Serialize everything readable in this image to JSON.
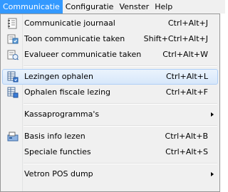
{
  "menubar": {
    "items": [
      {
        "label": "Communicatie"
      },
      {
        "label": "Configuratie"
      },
      {
        "label": "Venster"
      },
      {
        "label": "Help"
      }
    ]
  },
  "menu": {
    "items": [
      {
        "label": "Communicatie journaal",
        "shortcut": "Ctrl+Alt+J",
        "icon": "journal-icon"
      },
      {
        "label": "Toon communicatie taken",
        "shortcut": "Shift+Ctrl+Alt+J",
        "icon": "tasks-icon"
      },
      {
        "label": "Evalueer communicatie taken",
        "shortcut": "Ctrl+Alt+W",
        "icon": "evaluate-icon"
      },
      {
        "label": "Lezingen ophalen",
        "shortcut": "Ctrl+Alt+L",
        "icon": "fetch-readings-icon",
        "highlighted": true
      },
      {
        "label": "Ophalen fiscale lezing",
        "shortcut": "Ctrl+Alt+F",
        "icon": "fiscal-reading-icon"
      },
      {
        "label": "Kassaprogramma's",
        "submenu": true
      },
      {
        "label": "Basis info lezen",
        "shortcut": "Ctrl+Alt+B",
        "icon": "basic-info-icon"
      },
      {
        "label": "Speciale functies",
        "shortcut": "Ctrl+Alt+S"
      },
      {
        "label": "Vetron POS dump",
        "submenu": true
      }
    ]
  },
  "colors": {
    "menubar_active": "#3399ff",
    "highlight_border": "#aecff7"
  }
}
